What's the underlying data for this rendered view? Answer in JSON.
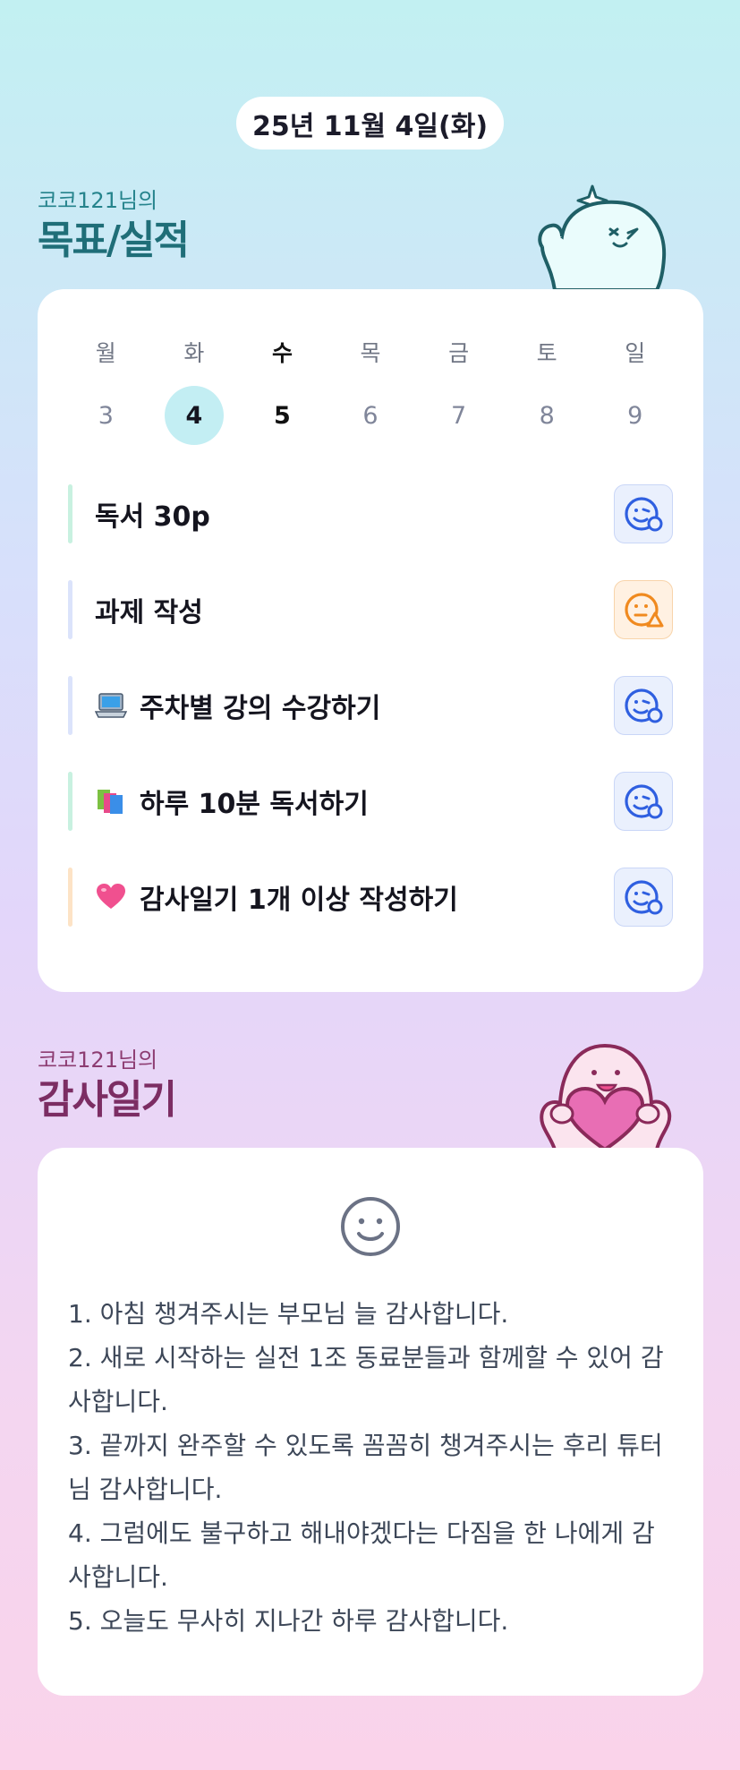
{
  "header": {
    "date": "25년 11월 4일(화)"
  },
  "goals_section": {
    "subtitle": "코코121님의",
    "title": "목표/실적",
    "weekdays": [
      "월",
      "화",
      "수",
      "목",
      "금",
      "토",
      "일"
    ],
    "dates": [
      "3",
      "4",
      "5",
      "6",
      "7",
      "8",
      "9"
    ],
    "selected_date": "4",
    "goals": [
      {
        "text": "독서 30p",
        "emoji": "",
        "bar_color": "#c8f1e0",
        "status": "smile-icon"
      },
      {
        "text": "과제 작성",
        "emoji": "",
        "bar_color": "#dbe3fb",
        "status": "warning-face-icon"
      },
      {
        "text": "주차별 강의 수강하기",
        "emoji": "laptop-icon",
        "bar_color": "#dbe3fb",
        "status": "smile-icon"
      },
      {
        "text": "하루 10분 독서하기",
        "emoji": "books-icon",
        "bar_color": "#c8f1e0",
        "status": "smile-icon"
      },
      {
        "text": "감사일기 1개 이상 작성하기",
        "emoji": "heart-icon",
        "bar_color": "#fde3c6",
        "status": "smile-icon"
      }
    ]
  },
  "gratitude_section": {
    "subtitle": "코코121님의",
    "title": "감사일기",
    "icon": "smile-icon",
    "lines": [
      "1. 아침 챙겨주시는 부모님 늘 감사합니다.",
      "2. 새로 시작하는 실전 1조 동료분들과 함께할 수 있어 감사합니다.",
      "3. 끝까지 완주할 수 있도록 꼼꼼히 챙겨주시는 후리 튜터님 감사합니다.",
      "4. 그럼에도 불구하고 해내야겠다는 다짐을 한 나에게 감사합니다.",
      "5. 오늘도 무사히 지나간 하루 감사합니다."
    ]
  },
  "colors": {
    "teal_title": "#1f6e78",
    "plum_title": "#7c2d63",
    "status_blue": "#2f5fe0",
    "status_orange": "#f08a1f"
  }
}
